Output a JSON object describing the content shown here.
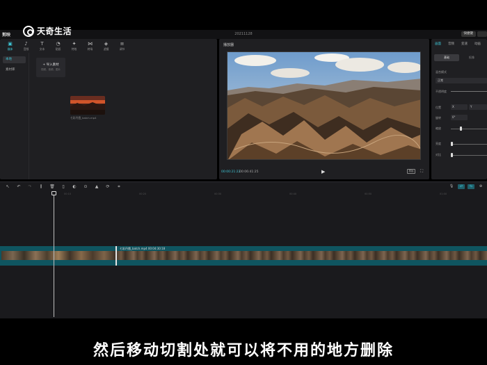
{
  "watermark": {
    "brand": "天奇生活"
  },
  "titlebar": {
    "app_name": "剪映",
    "project_title": "20211128",
    "shortcut_label": "快捷键"
  },
  "media": {
    "tabs": [
      {
        "label": "媒体",
        "icon": "media-icon"
      },
      {
        "label": "音频",
        "icon": "audio-icon"
      },
      {
        "label": "文本",
        "icon": "text-icon"
      },
      {
        "label": "贴纸",
        "icon": "sticker-icon"
      },
      {
        "label": "特效",
        "icon": "effects-icon"
      },
      {
        "label": "转场",
        "icon": "transition-icon"
      },
      {
        "label": "滤镜",
        "icon": "filter-icon"
      },
      {
        "label": "调节",
        "icon": "adjust-icon"
      }
    ],
    "side": [
      "本地",
      "素材库"
    ],
    "import_label": "+ 导入素材",
    "import_hint": "视频、音频、图片",
    "clip_name": "七彩丹霞_batch.mp4"
  },
  "player": {
    "title": "播放器",
    "time_current": "00:00:21:22",
    "time_total": "00:06:41:25",
    "ratio_label": "原始"
  },
  "props": {
    "tabs": [
      "画面",
      "音频",
      "变速",
      "动画"
    ],
    "subtabs": [
      "基础",
      "抠像"
    ],
    "blend_label": "混合模式",
    "blend_value": "正常",
    "opacity_label": "不透明度",
    "position_label": "位置",
    "pos_x": "X",
    "pos_y": "Y",
    "rotate_label": "旋转",
    "rotate_value": "0°",
    "scale_label": "缩放",
    "scale_level": 0.25,
    "brightness_label": "亮度",
    "contrast_label": "对比"
  },
  "timeline": {
    "ticks": [
      "00:10",
      "00:20",
      "00:30",
      "00:40",
      "00:50",
      "01:00"
    ],
    "clip_label": "七彩丹霞_batch.mp4    00:04:30:18"
  },
  "subtitle": "然后移动切割处就可以将不用的地方删除",
  "colors": {
    "accent": "#3ec6d6",
    "track": "#0f5560",
    "panel": "#1f1f22"
  }
}
